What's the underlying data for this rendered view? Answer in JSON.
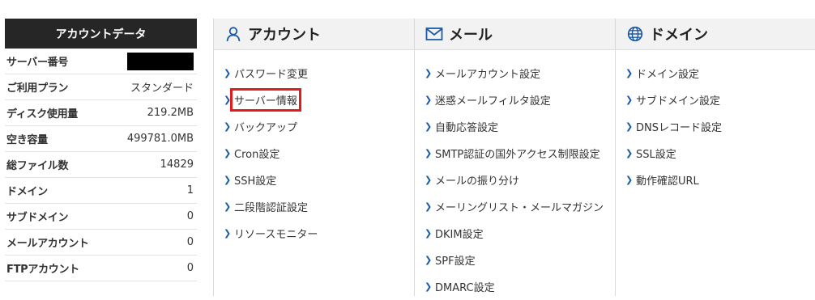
{
  "account_panel": {
    "title": "アカウントデータ",
    "rows": [
      {
        "label": "サーバー番号",
        "value": ""
      },
      {
        "label": "ご利用プラン",
        "value": "スタンダード"
      },
      {
        "label": "ディスク使用量",
        "value": "219.2MB"
      },
      {
        "label": "空き容量",
        "value": "499781.0MB"
      },
      {
        "label": "総ファイル数",
        "value": "14829"
      },
      {
        "label": "ドメイン",
        "value": "1"
      },
      {
        "label": "サブドメイン",
        "value": "0"
      },
      {
        "label": "メールアカウント",
        "value": "0"
      },
      {
        "label": "FTPアカウント",
        "value": "0"
      }
    ]
  },
  "menu": {
    "account": {
      "title": "アカウント",
      "icon": "user-icon",
      "items": [
        "パスワード変更",
        "サーバー情報",
        "バックアップ",
        "Cron設定",
        "SSH設定",
        "二段階認証設定",
        "リソースモニター"
      ]
    },
    "mail": {
      "title": "メール",
      "icon": "envelope-icon",
      "items": [
        "メールアカウント設定",
        "迷惑メールフィルタ設定",
        "自動応答設定",
        "SMTP認証の国外アクセス制限設定",
        "メールの振り分け",
        "メーリングリスト・メールマガジン",
        "DKIM設定",
        "SPF設定",
        "DMARC設定"
      ]
    },
    "domain": {
      "title": "ドメイン",
      "icon": "globe-icon",
      "items": [
        "ドメイン設定",
        "サブドメイン設定",
        "DNSレコード設定",
        "SSL設定",
        "動作確認URL"
      ]
    }
  },
  "colors": {
    "accent": "#1c5aa6",
    "highlight": "#e21b1b",
    "header_bg": "#262626"
  }
}
